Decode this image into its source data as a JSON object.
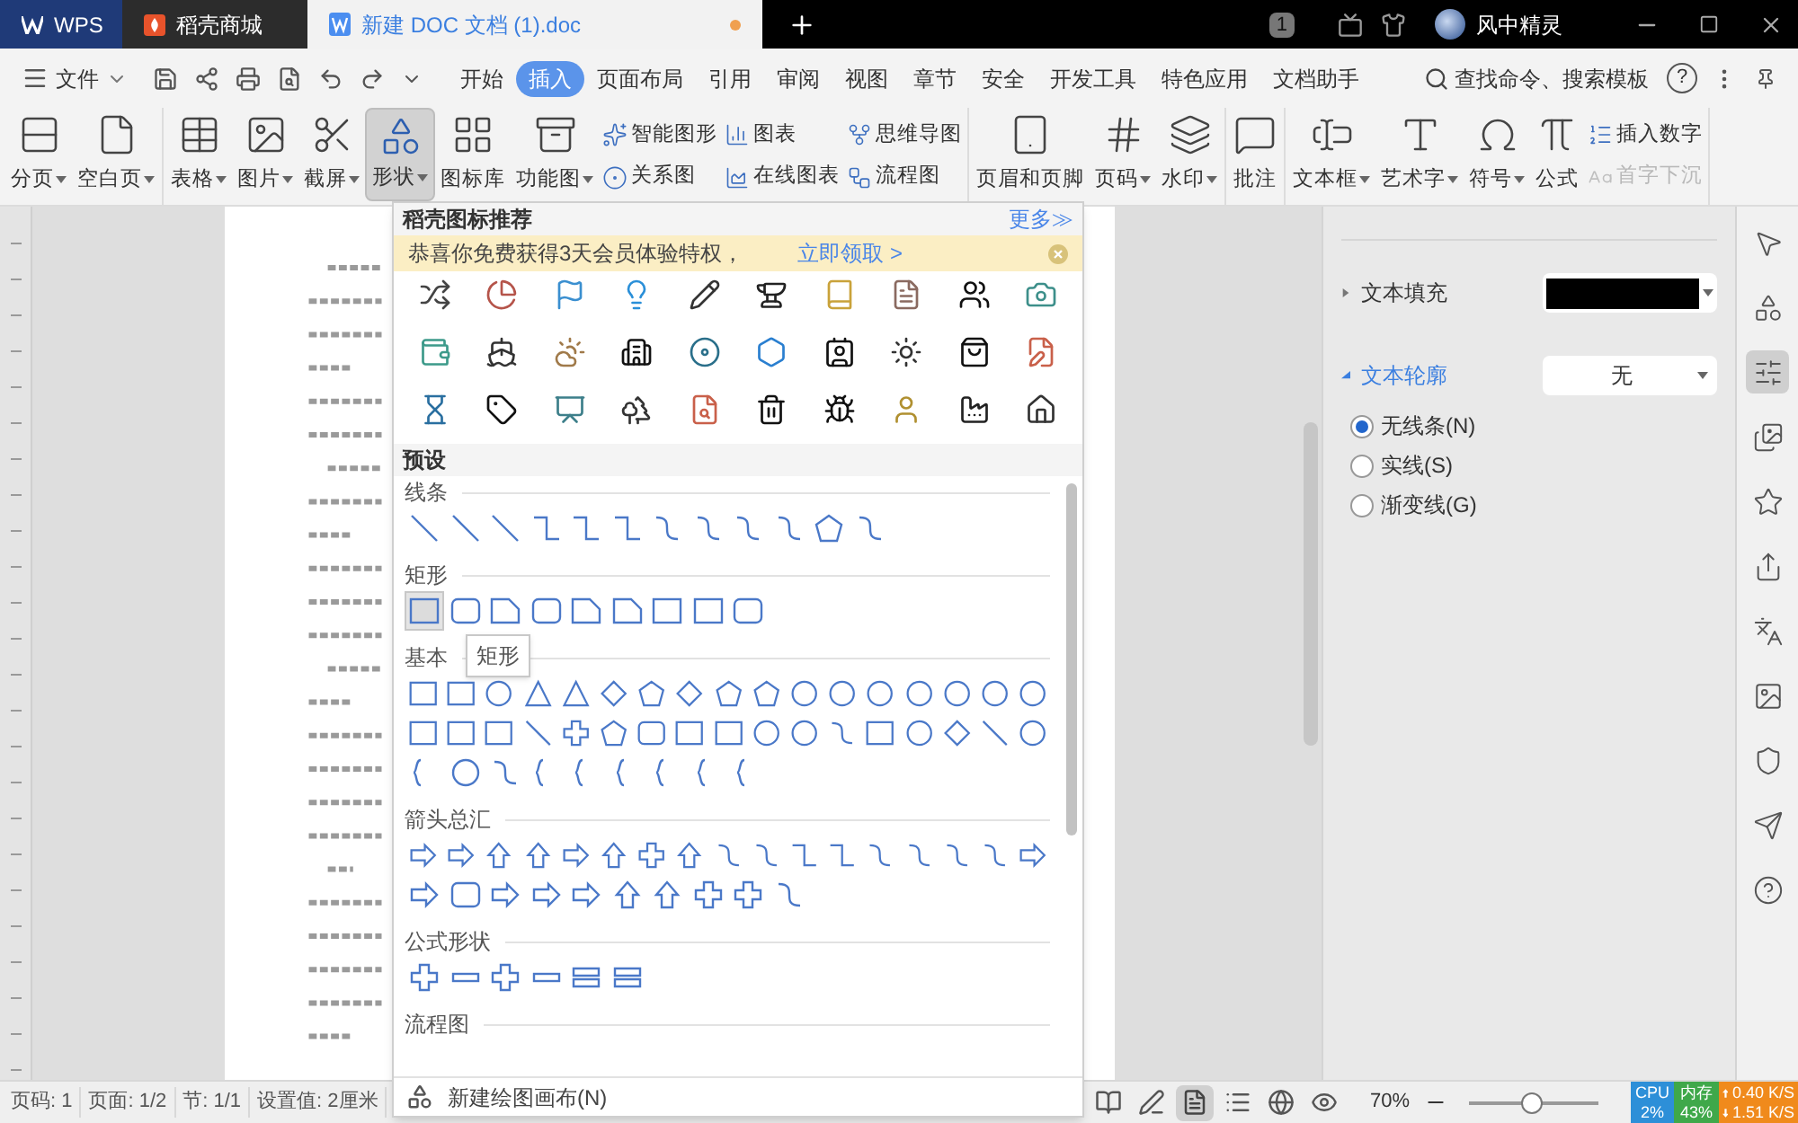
{
  "tabs": [
    {
      "label": "WPS",
      "kind": "app",
      "selected": false
    },
    {
      "label": "稻壳商城",
      "kind": "store",
      "selected": false
    },
    {
      "label": "新建 DOC 文档 (1).doc",
      "kind": "doc",
      "selected": true
    }
  ],
  "title_bar": {
    "badge": "1",
    "user": "风中精灵"
  },
  "menu": {
    "file": "文件",
    "tabs": [
      {
        "label": "开始",
        "selected": false
      },
      {
        "label": "插入",
        "selected": true
      },
      {
        "label": "页面布局",
        "selected": false
      },
      {
        "label": "引用",
        "selected": false
      },
      {
        "label": "审阅",
        "selected": false
      },
      {
        "label": "视图",
        "selected": false
      },
      {
        "label": "章节",
        "selected": false
      },
      {
        "label": "安全",
        "selected": false
      },
      {
        "label": "开发工具",
        "selected": false
      },
      {
        "label": "特色应用",
        "selected": false
      },
      {
        "label": "文档助手",
        "selected": false
      }
    ],
    "search": "查找命令、搜索模板",
    "help": "?"
  },
  "ribbon": [
    [
      {
        "kind": "large",
        "label": "分页",
        "dropdown": true,
        "selected": false
      },
      {
        "kind": "large",
        "label": "空白页",
        "dropdown": true,
        "selected": false
      }
    ],
    [
      {
        "kind": "large",
        "label": "表格",
        "dropdown": true,
        "selected": false
      },
      {
        "kind": "large",
        "label": "图片",
        "dropdown": true,
        "selected": false
      },
      {
        "kind": "large",
        "label": "截屏",
        "dropdown": true,
        "selected": false
      },
      {
        "kind": "large",
        "label": "形状",
        "dropdown": true,
        "selected": true
      },
      {
        "kind": "large",
        "label": "图标库",
        "dropdown": false,
        "selected": false
      },
      {
        "kind": "large",
        "label": "功能图",
        "dropdown": true,
        "selected": false
      },
      {
        "kind": "stack",
        "items": [
          {
            "label": "智能图形",
            "disabled": false
          },
          {
            "label": "关系图",
            "disabled": false
          }
        ]
      },
      {
        "kind": "stack",
        "items": [
          {
            "label": "图表",
            "disabled": false
          },
          {
            "label": "在线图表",
            "disabled": false
          }
        ]
      },
      {
        "kind": "stack",
        "items": [
          {
            "label": "思维导图",
            "disabled": false
          },
          {
            "label": "流程图",
            "disabled": false
          }
        ]
      }
    ],
    [
      {
        "kind": "large",
        "label": "页眉和页脚",
        "dropdown": false,
        "selected": false
      },
      {
        "kind": "large",
        "label": "页码",
        "dropdown": true,
        "selected": false
      },
      {
        "kind": "large",
        "label": "水印",
        "dropdown": true,
        "selected": false
      }
    ],
    [
      {
        "kind": "large",
        "label": "批注",
        "dropdown": false,
        "selected": false
      }
    ],
    [
      {
        "kind": "large",
        "label": "文本框",
        "dropdown": true,
        "selected": false
      },
      {
        "kind": "large",
        "label": "艺术字",
        "dropdown": true,
        "selected": false
      },
      {
        "kind": "large",
        "label": "符号",
        "dropdown": true,
        "selected": false
      },
      {
        "kind": "large",
        "label": "公式",
        "dropdown": false,
        "selected": false
      },
      {
        "kind": "stack",
        "items": [
          {
            "label": "插入数字",
            "disabled": false
          },
          {
            "label": "首字下沉",
            "disabled": true
          }
        ]
      }
    ]
  ],
  "shapes_menu": {
    "title": "稻壳图标推荐",
    "more": "更多≫",
    "promo": {
      "text": "恭喜你免费获得3天会员体验特权，",
      "link": "立即领取 >"
    },
    "preset_title": "预设",
    "sections": [
      {
        "title": "线条"
      },
      {
        "title": "矩形"
      },
      {
        "title": "基本"
      },
      {
        "title": "箭头总汇"
      },
      {
        "title": "公式形状"
      },
      {
        "title": "流程图"
      }
    ],
    "tooltip": "矩形",
    "footer": "新建绘图画布(N)"
  },
  "format_panel": {
    "fill": {
      "label": "文本填充",
      "expanded": false
    },
    "outline": {
      "label": "文本轮廓",
      "expanded": true,
      "value": "无"
    },
    "options": [
      {
        "label": "无线条(N)",
        "selected": true
      },
      {
        "label": "实线(S)",
        "selected": false
      },
      {
        "label": "渐变线(G)",
        "selected": false
      }
    ]
  },
  "status_bar": {
    "items": [
      "页码: 1",
      "页面: 1/2",
      "节: 1/1",
      "设置值: 2厘米"
    ],
    "zoom": "70%",
    "zoom_level": {
      "level": 0.48
    }
  },
  "monitor": {
    "cpu_label": "CPU",
    "cpu": "2%",
    "mem_label": "内存",
    "mem": "43%",
    "up": "0.40 K/S",
    "down": "1.51 K/S"
  }
}
